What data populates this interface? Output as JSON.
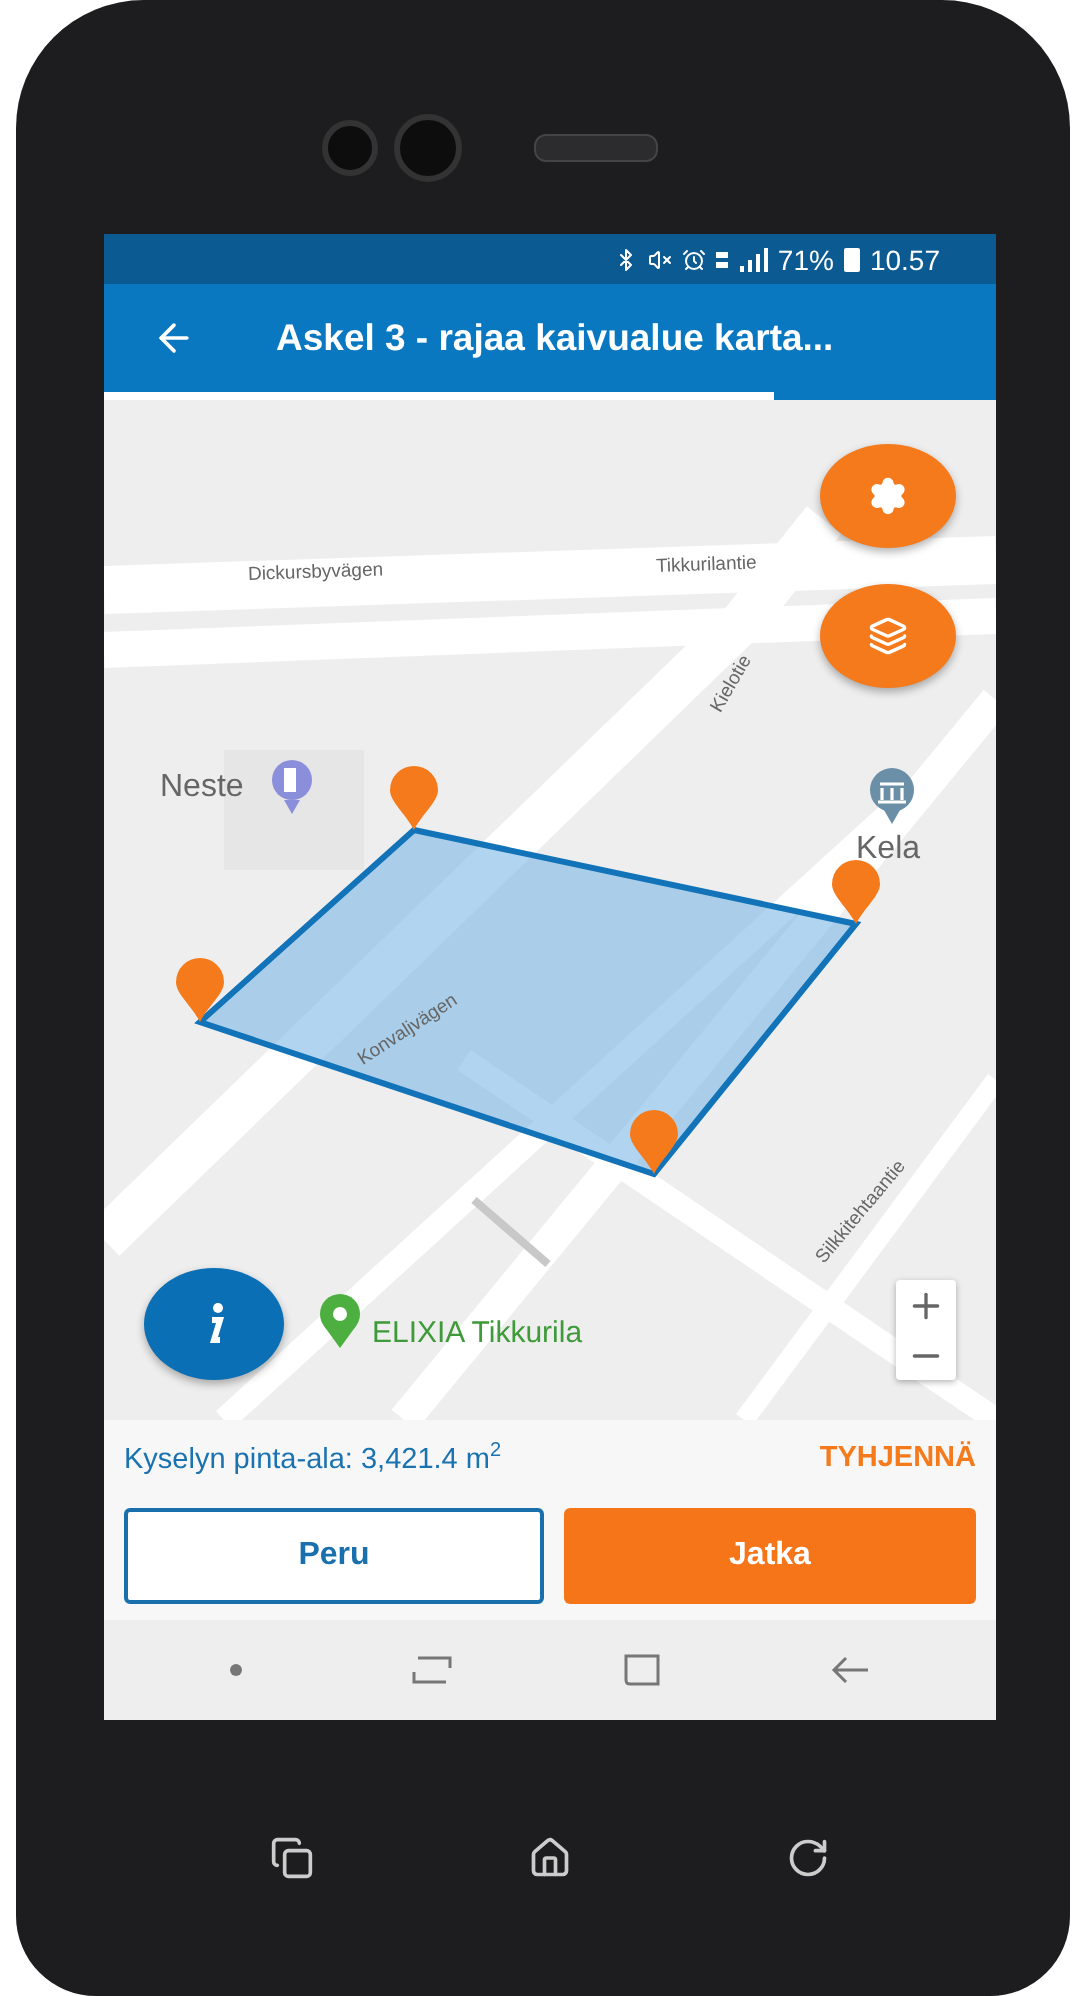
{
  "status_bar": {
    "battery": "71%",
    "time": "10.57"
  },
  "header": {
    "title": "Askel 3 - rajaa kaivualue karta...",
    "progress": {
      "level": 0.75
    }
  },
  "map": {
    "labels": [
      {
        "kind": "road",
        "text": "Dickursbyvägen"
      },
      {
        "kind": "road",
        "text": "Tikkurilantie"
      },
      {
        "kind": "road",
        "text": "Kielotie"
      },
      {
        "kind": "place",
        "text": "Neste"
      },
      {
        "kind": "place",
        "text": "Kela"
      },
      {
        "kind": "road",
        "text": "Konvaljvägen"
      },
      {
        "kind": "road",
        "text": "Silkkitehtaantie"
      },
      {
        "kind": "poi",
        "text": "ELIXIA Tikkurila"
      }
    ]
  },
  "area": {
    "text": "Kyselyn pinta-ala: 3,421.4 m$^{2}$",
    "clear_label": "TYHJENNÄ"
  },
  "buttons": [
    {
      "label": "Peru",
      "kind": "secondary"
    },
    {
      "label": "Jatka",
      "kind": "primary"
    }
  ]
}
